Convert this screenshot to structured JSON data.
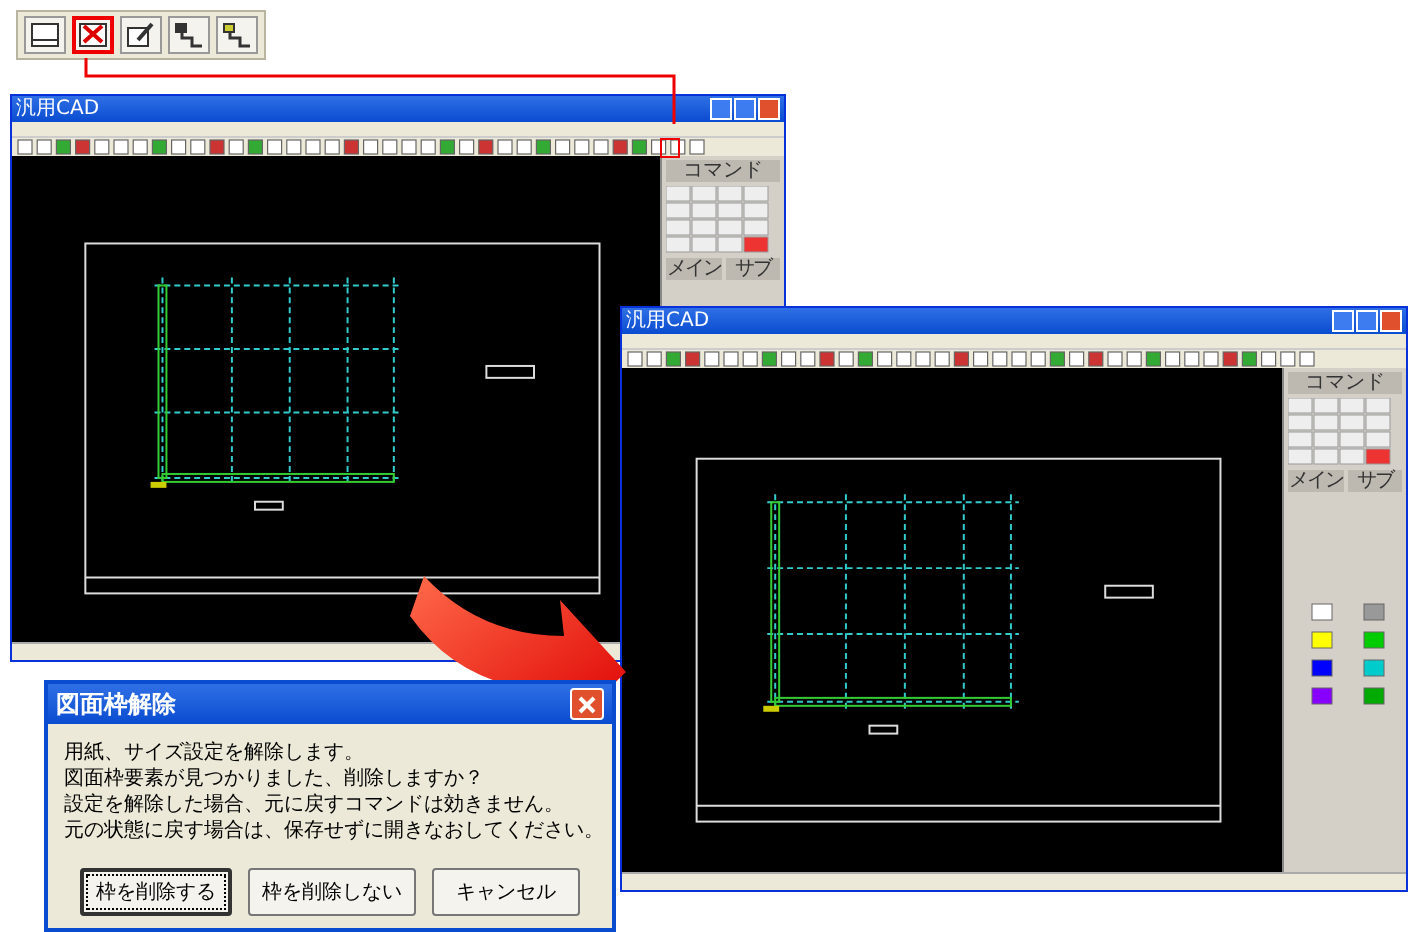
{
  "toolbar": {
    "buttons": [
      {
        "selected": false
      },
      {
        "selected": true
      },
      {
        "selected": false
      },
      {
        "selected": false
      },
      {
        "selected": false
      }
    ]
  },
  "windows": [
    {
      "title": "汎用CAD",
      "panel_labels": [
        "コマンド",
        "メイン",
        "サブ"
      ]
    },
    {
      "title": "汎用CAD",
      "panel_labels": [
        "コマンド",
        "メイン",
        "サブ"
      ]
    }
  ],
  "dialog": {
    "title": "図面枠解除",
    "lines": [
      "用紙、サイズ設定を解除します。",
      "図面枠要素が見つかりました、削除しますか？",
      "設定を解除した場合、元に戻すコマンドは効きません。",
      "元の状態に戻す場合は、保存せずに開きなおしてください。"
    ],
    "buttons": [
      {
        "label": "枠を削除する",
        "selected": true
      },
      {
        "label": "枠を削除しない",
        "selected": false
      },
      {
        "label": "キャンセル",
        "selected": false
      }
    ]
  }
}
